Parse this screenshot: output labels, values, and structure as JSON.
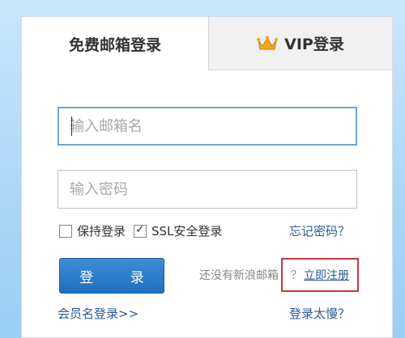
{
  "tabs": {
    "free_label": "免费邮箱登录",
    "vip_label": "VIP登录"
  },
  "form": {
    "email_placeholder": "输入邮箱名",
    "password_placeholder": "输入密码",
    "keep_login_label": "保持登录",
    "keep_login_checked": false,
    "ssl_label": "SSL安全登录",
    "ssl_checked": true,
    "forgot_label": "忘记密码？",
    "login_button": "登 录",
    "no_account_text": "还没有新浪邮箱",
    "register_link": "立即注册",
    "register_question": "？",
    "member_login": "会员名登录>>",
    "slow_login": "登录太慢？"
  },
  "colors": {
    "accent": "#2a7fd0",
    "link": "#2a5a9a",
    "highlight_border": "#c0393b",
    "crown": "#f0a81c"
  },
  "icons": {
    "vip": "crown-icon"
  }
}
